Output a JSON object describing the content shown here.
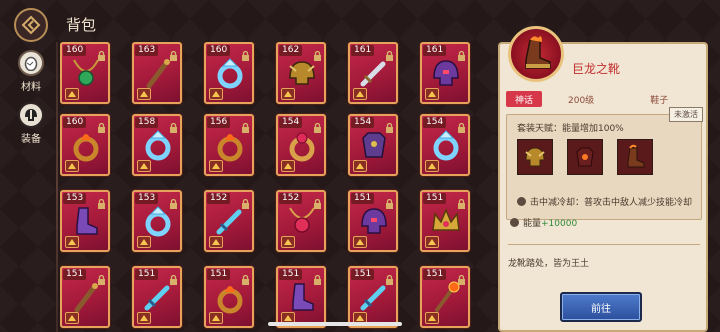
{
  "header": {
    "title": "背包"
  },
  "sidebar": {
    "items": [
      {
        "label": "材料",
        "icon": "egg-icon",
        "active": false
      },
      {
        "label": "装备",
        "icon": "helmet-icon",
        "active": true
      }
    ]
  },
  "grid": {
    "rows": [
      [
        {
          "level": "160",
          "icon": "emerald-necklace-icon"
        },
        {
          "level": "163",
          "icon": "wooden-staff-icon"
        },
        {
          "level": "160",
          "icon": "ice-ring-icon"
        },
        {
          "level": "162",
          "icon": "golden-helmet-icon"
        },
        {
          "level": "161",
          "icon": "steel-sword-icon"
        },
        {
          "level": "161",
          "icon": "purple-helmet-icon"
        }
      ],
      [
        {
          "level": "160",
          "icon": "fire-ring-icon"
        },
        {
          "level": "158",
          "icon": "ice-ring-icon"
        },
        {
          "level": "156",
          "icon": "fire-ring-icon"
        },
        {
          "level": "154",
          "icon": "ruby-ring-icon"
        },
        {
          "level": "154",
          "icon": "purple-armor-icon"
        },
        {
          "level": "154",
          "icon": "ice-ring-icon"
        }
      ],
      [
        {
          "level": "153",
          "icon": "purple-boots-icon"
        },
        {
          "level": "153",
          "icon": "ice-ring-icon"
        },
        {
          "level": "152",
          "icon": "ice-sword-icon"
        },
        {
          "level": "152",
          "icon": "ruby-necklace-icon"
        },
        {
          "level": "151",
          "icon": "purple-helmet-icon"
        },
        {
          "level": "151",
          "icon": "golden-crown-icon"
        }
      ],
      [
        {
          "level": "151",
          "icon": "wooden-staff-icon"
        },
        {
          "level": "151",
          "icon": "ice-sword-icon"
        },
        {
          "level": "151",
          "icon": "fire-ring-icon"
        },
        {
          "level": "151",
          "icon": "purple-boots-icon"
        },
        {
          "level": "151",
          "icon": "ice-sword-icon"
        },
        {
          "level": "151",
          "icon": "fire-staff-icon"
        }
      ]
    ]
  },
  "detail": {
    "name": "巨龙之靴",
    "rarity": "神话",
    "level": "200级",
    "type": "鞋子",
    "set_status": "未激活",
    "set_bonus": "套装天赋：能量增加100%",
    "set_items": [
      "golden-helmet-icon",
      "fire-armor-icon",
      "fire-boots-icon"
    ],
    "effect_text": "击中减冷却：普攻击中敌人减少技能冷却",
    "stat_label": "能量",
    "stat_value": "+10000",
    "flavor": "龙靴踏处，皆为王土",
    "button_label": "前往"
  },
  "colors": {
    "slot_red": "#b8203f",
    "slot_border": "#e6a35b",
    "name_red": "#c22f2f",
    "rarity_bg": "#d6384a",
    "stat_green": "#2f8a3a",
    "button_blue": "#3a63b6"
  }
}
